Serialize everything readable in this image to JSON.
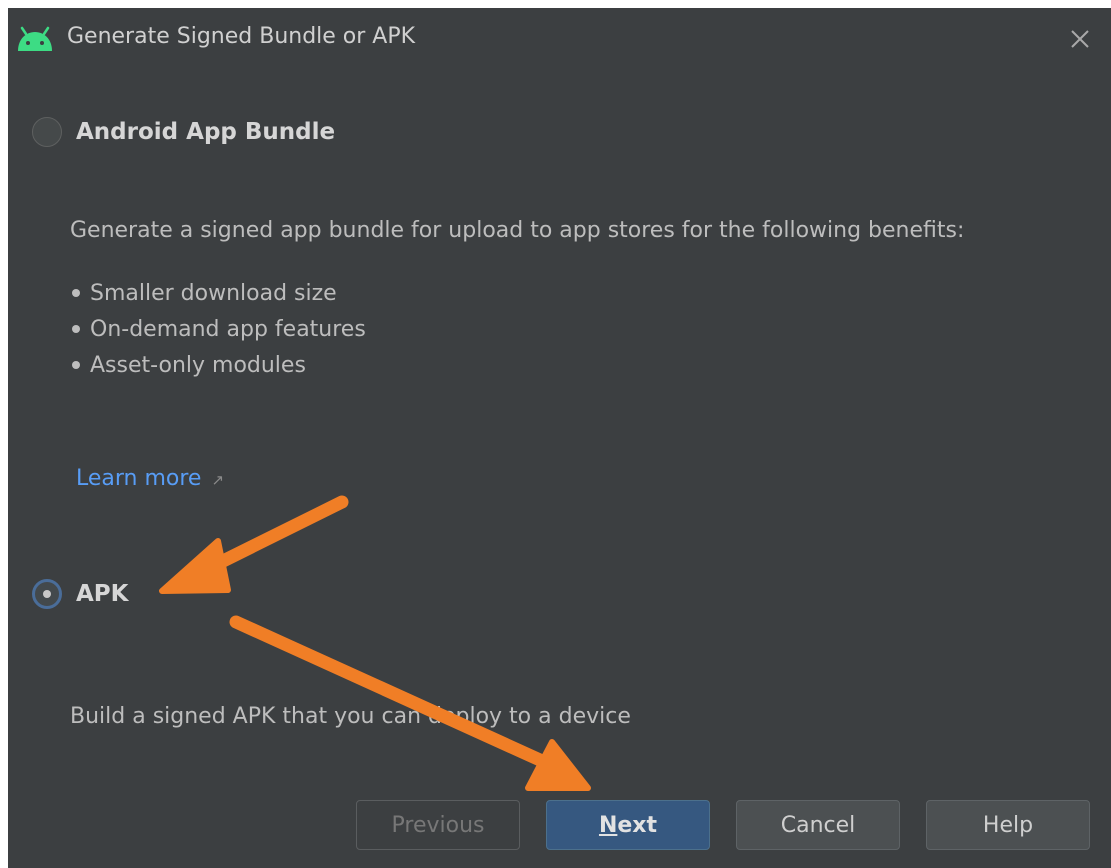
{
  "window": {
    "title": "Generate Signed Bundle or APK",
    "icon": "android-icon",
    "close_icon": "close-icon"
  },
  "options": {
    "bundle": {
      "label": "Android App Bundle",
      "selected": false,
      "description": "Generate a signed app bundle for upload to app stores for the following benefits:",
      "benefits": [
        "Smaller download size",
        "On-demand app features",
        "Asset-only modules"
      ],
      "learn_more": "Learn more",
      "learn_more_icon": "external-link-icon"
    },
    "apk": {
      "label": "APK",
      "selected": true,
      "description": "Build a signed APK that you can deploy to a device"
    }
  },
  "buttons": {
    "previous": "Previous",
    "next": "Next",
    "next_mnemonic": "N",
    "next_rest": "ext",
    "cancel": "Cancel",
    "help": "Help"
  },
  "annotations": {
    "arrow_color": "#f07e26",
    "arrows": [
      "arrow-to-apk-option",
      "arrow-to-next-button"
    ]
  },
  "colors": {
    "dialog_bg": "#3c3f41",
    "link": "#589df6",
    "primary_button": "#365880",
    "android_green": "#3ddc84"
  }
}
